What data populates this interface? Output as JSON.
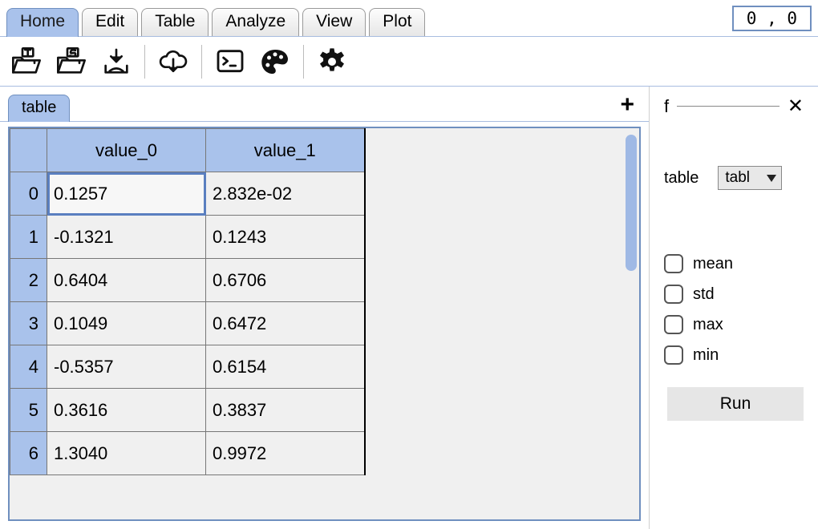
{
  "menu": {
    "tabs": [
      "Home",
      "Edit",
      "Table",
      "Analyze",
      "View",
      "Plot"
    ],
    "active_index": 0
  },
  "coord": "0 , 0",
  "toolbar": {
    "icons": [
      "open-t-icon",
      "open-s-icon",
      "import-icon",
      "cloud-download-icon",
      "console-icon",
      "palette-icon",
      "gear-icon"
    ]
  },
  "table_tabs": {
    "items": [
      "table"
    ],
    "active_index": 0,
    "add_symbol": "+"
  },
  "grid": {
    "columns": [
      "value_0",
      "value_1"
    ],
    "rows": [
      {
        "idx": "0",
        "cells": [
          "0.1257",
          "2.832e-02"
        ]
      },
      {
        "idx": "1",
        "cells": [
          "-0.1321",
          "0.1243"
        ]
      },
      {
        "idx": "2",
        "cells": [
          "0.6404",
          "0.6706"
        ]
      },
      {
        "idx": "3",
        "cells": [
          "0.1049",
          "0.6472"
        ]
      },
      {
        "idx": "4",
        "cells": [
          "-0.5357",
          "0.6154"
        ]
      },
      {
        "idx": "5",
        "cells": [
          "0.3616",
          "0.3837"
        ]
      },
      {
        "idx": "6",
        "cells": [
          "1.3040",
          "0.9972"
        ]
      }
    ],
    "selected": {
      "row": 0,
      "col": 0
    }
  },
  "side": {
    "f_label": "f",
    "close": "✕",
    "table_label": "table",
    "table_select": "tabl",
    "checks": [
      "mean",
      "std",
      "max",
      "min"
    ],
    "run_label": "Run"
  }
}
